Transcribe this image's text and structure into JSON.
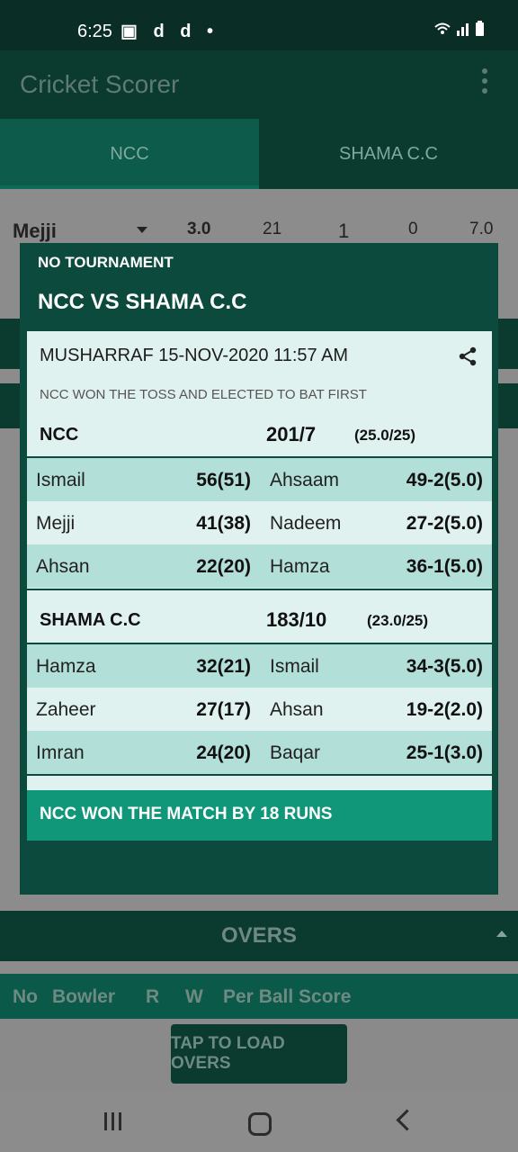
{
  "status_bar": {
    "time": "6:25",
    "notif_icons": "▣ d d •",
    "right_icons": "wifi signal battery"
  },
  "app_bar": {
    "title": "Cricket Scorer"
  },
  "tabs": [
    {
      "label": "NCC"
    },
    {
      "label": "SHAMA C.C"
    }
  ],
  "background_row": {
    "player": "Mejji",
    "overs": "3.0",
    "runs": "21",
    "maidens": "1",
    "wickets": "0",
    "economy": "7.0"
  },
  "dialog": {
    "tournament": "NO TOURNAMENT",
    "match_title": "NCC VS SHAMA C.C",
    "meta": "MUSHARRAF  15-NOV-2020 11:57 AM",
    "toss": "NCC WON THE TOSS AND ELECTED TO BAT FIRST",
    "innings": [
      {
        "team": "NCC",
        "score": "201/7",
        "overs": "(25.0/25)",
        "rows": [
          {
            "batsman": "Ismail",
            "bat_score": "56(51)",
            "bowler": "Ahsaam",
            "bowl_figures": "49-2(5.0)"
          },
          {
            "batsman": "Mejji",
            "bat_score": "41(38)",
            "bowler": "Nadeem",
            "bowl_figures": "27-2(5.0)"
          },
          {
            "batsman": "Ahsan",
            "bat_score": "22(20)",
            "bowler": "Hamza",
            "bowl_figures": "36-1(5.0)"
          }
        ]
      },
      {
        "team": "SHAMA C.C",
        "score": "183/10",
        "overs": "(23.0/25)",
        "rows": [
          {
            "batsman": "Hamza",
            "bat_score": "32(21)",
            "bowler": "Ismail",
            "bowl_figures": "34-3(5.0)"
          },
          {
            "batsman": "Zaheer",
            "bat_score": "27(17)",
            "bowler": "Ahsan",
            "bowl_figures": "19-2(2.0)"
          },
          {
            "batsman": "Imran",
            "bat_score": "24(20)",
            "bowler": "Baqar",
            "bowl_figures": "25-1(3.0)"
          }
        ]
      }
    ],
    "result": "NCC WON THE MATCH BY 18 RUNS"
  },
  "overs_section": {
    "title": "OVERS",
    "headers": {
      "no": "No",
      "bowler": "Bowler",
      "runs": "R",
      "wickets": "W",
      "per_ball": "Per Ball Score"
    },
    "load_button": "TAP TO LOAD OVERS"
  },
  "colors": {
    "primary_dark": "#0b3a2f",
    "accent": "#109678",
    "row_dark": "#b2dfd8",
    "row_light": "#e0f2ef"
  }
}
